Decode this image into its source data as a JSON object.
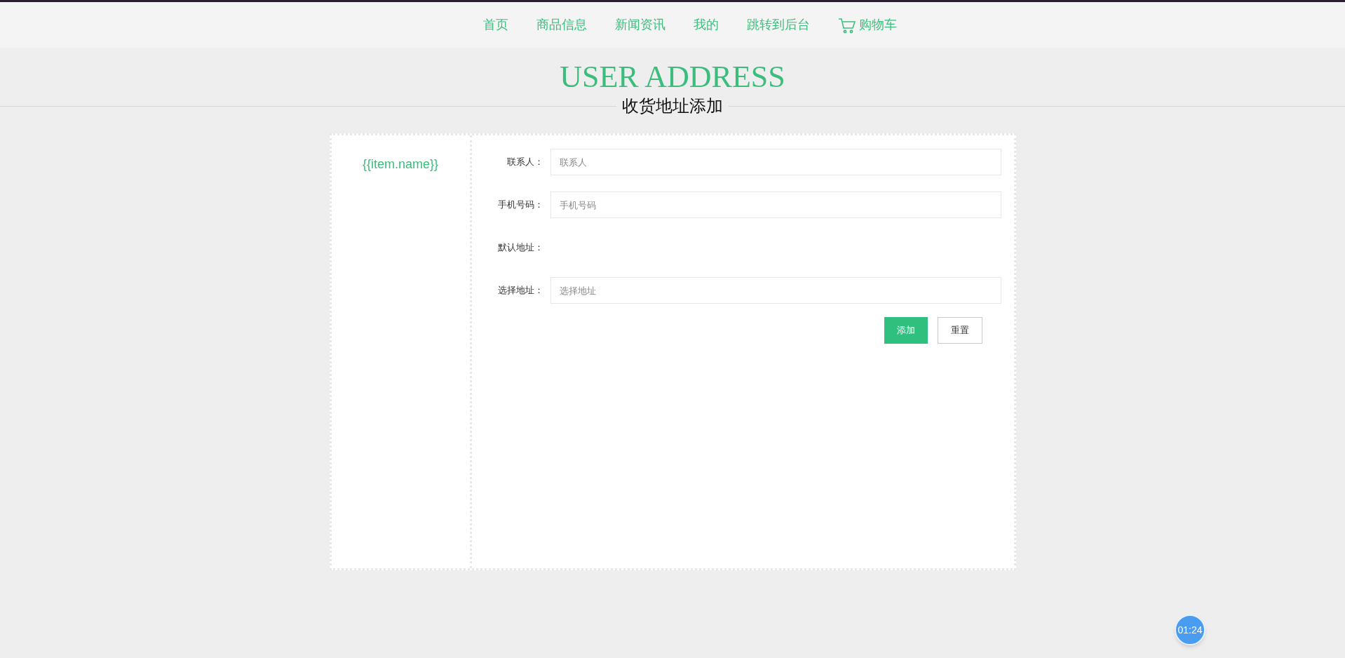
{
  "nav": {
    "items": [
      {
        "label": "首页",
        "kind": "link"
      },
      {
        "label": "商品信息",
        "kind": "link"
      },
      {
        "label": "新闻资讯",
        "kind": "link"
      },
      {
        "label": "我的",
        "kind": "link"
      },
      {
        "label": "跳转到后台",
        "kind": "link"
      },
      {
        "label": "购物车",
        "kind": "cart"
      }
    ]
  },
  "header": {
    "title": "USER ADDRESS",
    "subtitle": "收货地址添加"
  },
  "sidebar": {
    "items": [
      {
        "label": "{{item.name}}"
      }
    ]
  },
  "form": {
    "fields": [
      {
        "label": "联系人：",
        "kind": "input",
        "placeholder": "联系人"
      },
      {
        "label": "手机号码：",
        "kind": "input",
        "placeholder": "手机号码"
      },
      {
        "label": "默认地址：",
        "kind": "empty"
      },
      {
        "label": "选择地址：",
        "kind": "input",
        "placeholder": "选择地址"
      }
    ],
    "buttons": [
      {
        "label": "添加",
        "kind": "primary"
      },
      {
        "label": "重置",
        "kind": "secondary"
      }
    ]
  },
  "timer": {
    "text": "01:24"
  }
}
